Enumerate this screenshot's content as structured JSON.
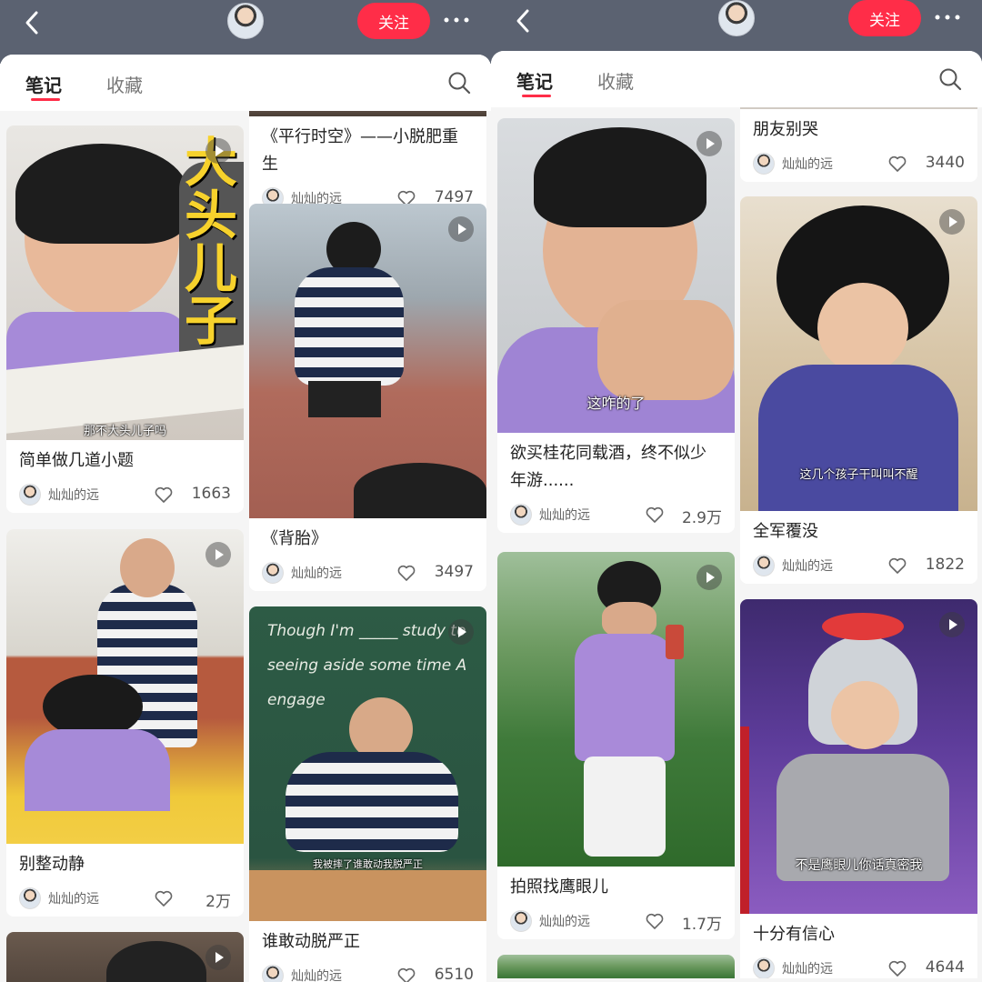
{
  "header": {
    "follow_label": "关注"
  },
  "tabs": {
    "notes": "笔记",
    "favorites": "收藏"
  },
  "left": {
    "cards": [
      {
        "caption": "那不大头儿子吗",
        "title": "简单做几道小题",
        "author": "灿灿的远",
        "likes": "1663",
        "overlay": "大头儿子"
      },
      {
        "caption": "",
        "title": "别整动静",
        "author": "灿灿的远",
        "likes": "2万"
      },
      {
        "caption": "",
        "title": "《平行时空》——小脱肥重生",
        "author": "灿灿的远",
        "likes": "7497"
      },
      {
        "caption": "",
        "title": "《背胎》",
        "author": "灿灿的远",
        "likes": "3497"
      },
      {
        "caption": "我被摔了谁敢动我脱严正",
        "title": "谁敢动脱严正",
        "author": "灿灿的远",
        "likes": "6510",
        "board_text": "Though I'm _____ study to seeing aside some time  A engage"
      }
    ]
  },
  "right": {
    "cards": [
      {
        "caption": "这咋的了",
        "title": "欲买桂花同载酒，终不似少年游......",
        "author": "灿灿的远",
        "likes": "2.9万"
      },
      {
        "caption": "",
        "title": "拍照找鹰眼儿",
        "author": "灿灿的远",
        "likes": "1.7万"
      },
      {
        "caption": "",
        "title": "朋友别哭",
        "author": "灿灿的远",
        "likes": "3440"
      },
      {
        "caption": "这几个孩子干叫叫不醒",
        "title": "全军覆没",
        "author": "灿灿的远",
        "likes": "1822"
      },
      {
        "caption": "不是鹰眼儿你话真密我",
        "title": "十分有信心",
        "author": "灿灿的远",
        "likes": "4644"
      }
    ]
  },
  "colors": {
    "accent": "#ff2d48",
    "topbar": "#5b6271"
  }
}
